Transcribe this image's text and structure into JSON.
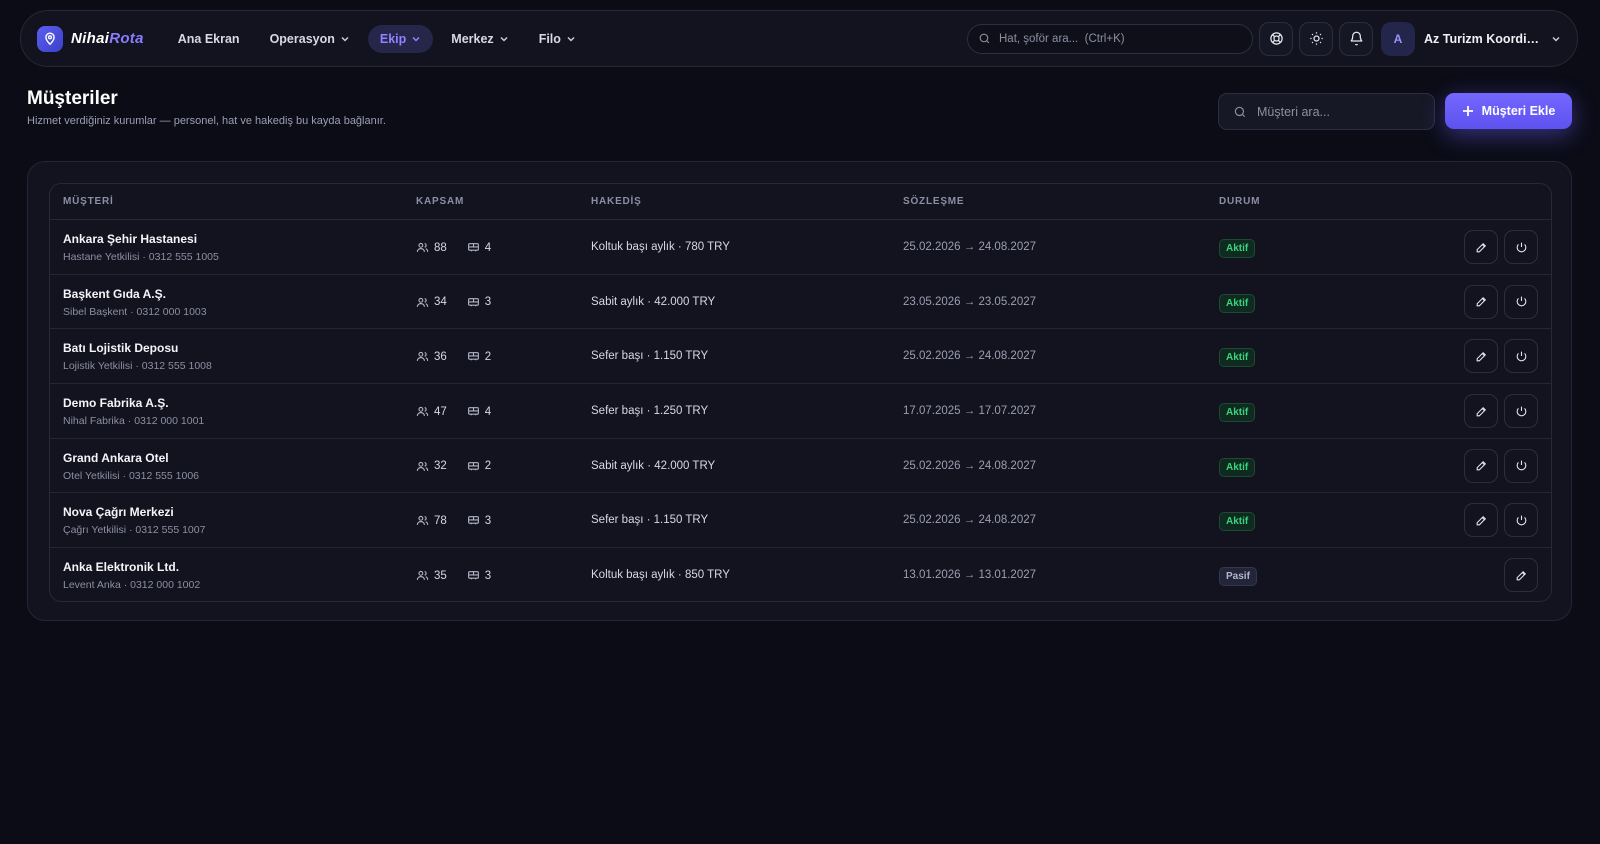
{
  "brand": {
    "name_a": "Nihai",
    "name_b": "Rota"
  },
  "nav": [
    {
      "label": "Ana Ekran",
      "dropdown": false,
      "active": false
    },
    {
      "label": "Operasyon",
      "dropdown": true,
      "active": false
    },
    {
      "label": "Ekip",
      "dropdown": true,
      "active": true
    },
    {
      "label": "Merkez",
      "dropdown": true,
      "active": false
    },
    {
      "label": "Filo",
      "dropdown": true,
      "active": false
    }
  ],
  "top_search": {
    "placeholder": "Hat, şoför ara...  (Ctrl+K)"
  },
  "user": {
    "initial": "A",
    "name": "Az Turizm Koordinatörlüğü"
  },
  "page": {
    "title": "Müşteriler",
    "subtitle": "Hizmet verdiğiniz kurumlar — personel, hat ve hakediş bu kayda bağlanır.",
    "search_placeholder": "Müşteri ara...",
    "add_label": "Müşteri Ekle"
  },
  "table": {
    "headers": {
      "customer": "MÜŞTERİ",
      "scope": "KAPSAM",
      "payment": "HAKEDİŞ",
      "contract": "SÖZLEŞME",
      "status": "DURUM"
    },
    "rows": [
      {
        "name": "Ankara Şehir Hastanesi",
        "contact": "Hastane Yetkilisi · 0312 555 1005",
        "people": "88",
        "lines": "4",
        "payment": "Koltuk başı aylık · 780 TRY",
        "contract": "25.02.2026 → 24.08.2027",
        "status": "Aktif",
        "active": true
      },
      {
        "name": "Başkent Gıda A.Ş.",
        "contact": "Sibel Başkent · 0312 000 1003",
        "people": "34",
        "lines": "3",
        "payment": "Sabit aylık · 42.000 TRY",
        "contract": "23.05.2026 → 23.05.2027",
        "status": "Aktif",
        "active": true
      },
      {
        "name": "Batı Lojistik Deposu",
        "contact": "Lojistik Yetkilisi · 0312 555 1008",
        "people": "36",
        "lines": "2",
        "payment": "Sefer başı · 1.150 TRY",
        "contract": "25.02.2026 → 24.08.2027",
        "status": "Aktif",
        "active": true
      },
      {
        "name": "Demo Fabrika A.Ş.",
        "contact": "Nihal Fabrika · 0312 000 1001",
        "people": "47",
        "lines": "4",
        "payment": "Sefer başı · 1.250 TRY",
        "contract": "17.07.2025 → 17.07.2027",
        "status": "Aktif",
        "active": true
      },
      {
        "name": "Grand Ankara Otel",
        "contact": "Otel Yetkilisi · 0312 555 1006",
        "people": "32",
        "lines": "2",
        "payment": "Sabit aylık · 42.000 TRY",
        "contract": "25.02.2026 → 24.08.2027",
        "status": "Aktif",
        "active": true
      },
      {
        "name": "Nova Çağrı Merkezi",
        "contact": "Çağrı Yetkilisi · 0312 555 1007",
        "people": "78",
        "lines": "3",
        "payment": "Sefer başı · 1.150 TRY",
        "contract": "25.02.2026 → 24.08.2027",
        "status": "Aktif",
        "active": true
      },
      {
        "name": "Anka Elektronik Ltd.",
        "contact": "Levent Anka · 0312 000 1002",
        "people": "35",
        "lines": "3",
        "payment": "Koltuk başı aylık · 850 TRY",
        "contract": "13.01.2026 → 13.01.2027",
        "status": "Pasif",
        "active": false
      }
    ]
  },
  "colors": {
    "accent": "#6f63ff",
    "active_green": "#38d47f",
    "background": "#0b0c16"
  },
  "icons": [
    "search-icon",
    "support-icon",
    "sun-icon",
    "bell-icon",
    "chevron-down-icon",
    "plus-icon",
    "users-icon",
    "bus-icon",
    "edit-icon",
    "power-icon"
  ]
}
